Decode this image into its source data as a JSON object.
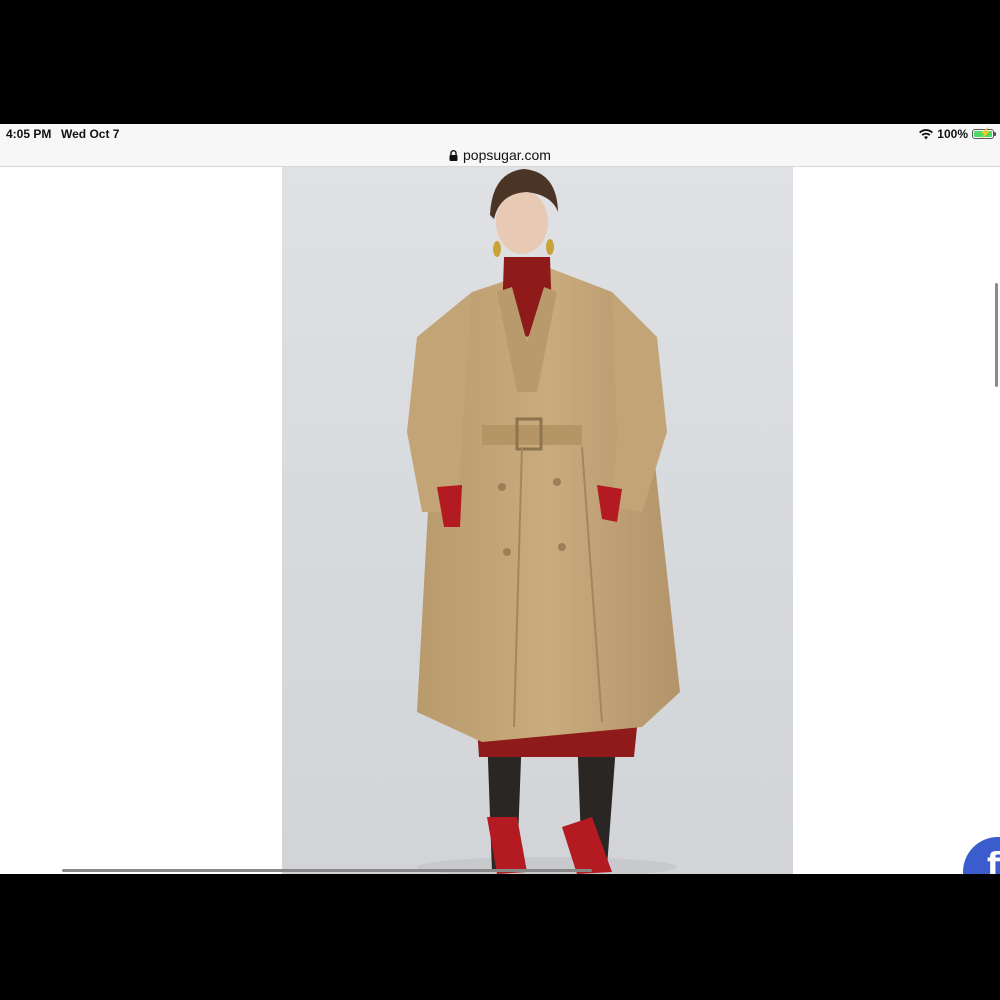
{
  "status_bar": {
    "time": "4:05 PM",
    "date": "Wed Oct 7",
    "battery_percent": "100%",
    "icons": [
      "wifi-icon",
      "battery-icon"
    ]
  },
  "browser": {
    "url": "popsugar.com",
    "secure_icon": "lock-icon"
  },
  "page": {
    "photo_alt": "fashion-photo",
    "share_button_icon": "facebook-icon",
    "share_button_glyph": "f"
  },
  "colors": {
    "coat": "#c4a67a",
    "red_top": "#8e1a1a",
    "background_photo": "#dcdfe2",
    "facebook_blue": "#3b5ccc",
    "battery_green": "#4cd964"
  }
}
